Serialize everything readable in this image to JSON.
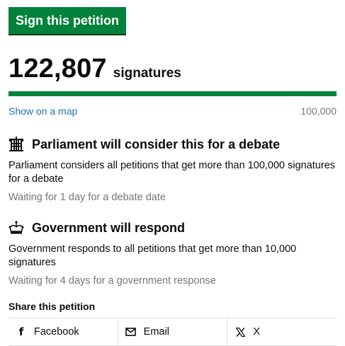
{
  "sign_button": {
    "label": "Sign this petition",
    "color": "#00823b"
  },
  "signatures": {
    "count": "122,807",
    "label": "signatures",
    "progress_fraction": 1.0,
    "show_on_map": "Show on a map",
    "target": "100,000"
  },
  "debate": {
    "icon": "portcullis-icon",
    "title": "Parliament will consider this for a debate",
    "text": "Parliament considers all petitions that get more than 100,000 signatures for a debate",
    "waiting": "Waiting for 1 day for a debate date"
  },
  "response": {
    "icon": "crown-icon",
    "title": "Government will respond",
    "text": "Government responds to all petitions that get more than 10,000 signatures",
    "waiting": "Waiting for 4 days for a government response"
  },
  "share": {
    "title": "Share this petition",
    "items": [
      {
        "icon": "facebook-icon",
        "label": "Facebook"
      },
      {
        "icon": "email-icon",
        "label": "Email"
      },
      {
        "icon": "x-icon",
        "label": "X"
      }
    ]
  }
}
